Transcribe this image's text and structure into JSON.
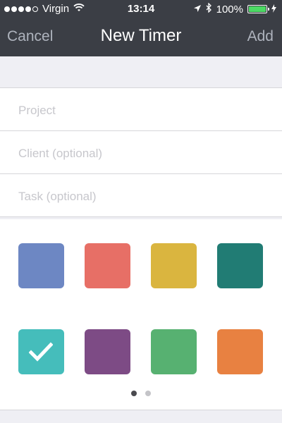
{
  "status_bar": {
    "carrier": "Virgin",
    "time": "13:14",
    "battery_text": "100%",
    "signal_bars_filled": 4,
    "signal_bars_total": 5
  },
  "nav": {
    "cancel_label": "Cancel",
    "title": "New Timer",
    "add_label": "Add"
  },
  "form": {
    "project": {
      "value": "",
      "placeholder": "Project"
    },
    "client": {
      "value": "",
      "placeholder": "Client (optional)"
    },
    "task": {
      "value": "",
      "placeholder": "Task (optional)"
    }
  },
  "colors": {
    "swatches": [
      {
        "name": "blue",
        "hex": "#6d87c3",
        "selected": false
      },
      {
        "name": "red",
        "hex": "#e76f66",
        "selected": false
      },
      {
        "name": "yellow",
        "hex": "#dab53f",
        "selected": false
      },
      {
        "name": "teal-dark",
        "hex": "#217c74",
        "selected": false
      },
      {
        "name": "turquoise",
        "hex": "#45bdbb",
        "selected": true
      },
      {
        "name": "purple",
        "hex": "#7d4b85",
        "selected": false
      },
      {
        "name": "green",
        "hex": "#57b171",
        "selected": false
      },
      {
        "name": "orange",
        "hex": "#e88141",
        "selected": false
      }
    ],
    "page_current": 1,
    "page_count": 2
  }
}
